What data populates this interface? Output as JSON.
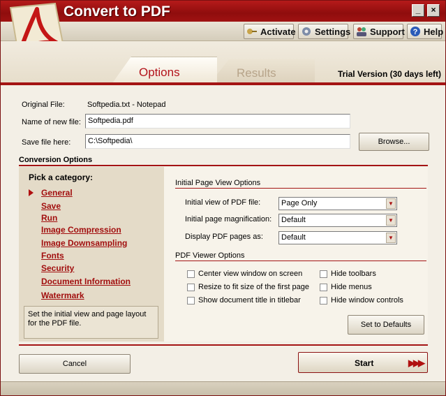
{
  "window": {
    "title": "Convert to PDF"
  },
  "toolbar": {
    "activate": "Activate",
    "settings": "Settings",
    "support": "Support",
    "help": "Help"
  },
  "tabs": {
    "options": "Options",
    "results": "Results"
  },
  "trial": "Trial Version (30 days left)",
  "form": {
    "original_file_label": "Original File:",
    "original_file_value": "Softpedia.txt - Notepad",
    "new_name_label": "Name of new  file:",
    "new_name_value": "Softpedia.pdf",
    "save_label": "Save file here:",
    "save_value": "C:\\Softpedia\\",
    "browse": "Browse..."
  },
  "conversion": {
    "title": "Conversion Options",
    "pick_category": "Pick a category:",
    "categories": [
      "General",
      "Save",
      "Run",
      "Image Compression",
      "Image Downsampling",
      "Fonts",
      "Security",
      "Document Information",
      "Watermark"
    ],
    "selected": "General",
    "help_text": "Set the initial view and page layout for the PDF file."
  },
  "initial_view": {
    "title": "Initial Page View Options",
    "view_label": "Initial view of PDF file:",
    "view_value": "Page Only",
    "mag_label": "Initial page magnification:",
    "mag_value": "Default",
    "display_label": "Display PDF pages as:",
    "display_value": "Default"
  },
  "viewer": {
    "title": "PDF Viewer Options",
    "center": "Center view window on screen",
    "resize": "Resize to fit size of the first page",
    "show_title": "Show document title in titlebar",
    "hide_toolbars": "Hide toolbars",
    "hide_menus": "Hide menus",
    "hide_controls": "Hide window controls",
    "defaults": "Set to Defaults"
  },
  "actions": {
    "cancel": "Cancel",
    "start": "Start",
    "start_arrows": "▶▶▶"
  },
  "colors": {
    "accent": "#a41414",
    "link": "#a10e0e"
  }
}
